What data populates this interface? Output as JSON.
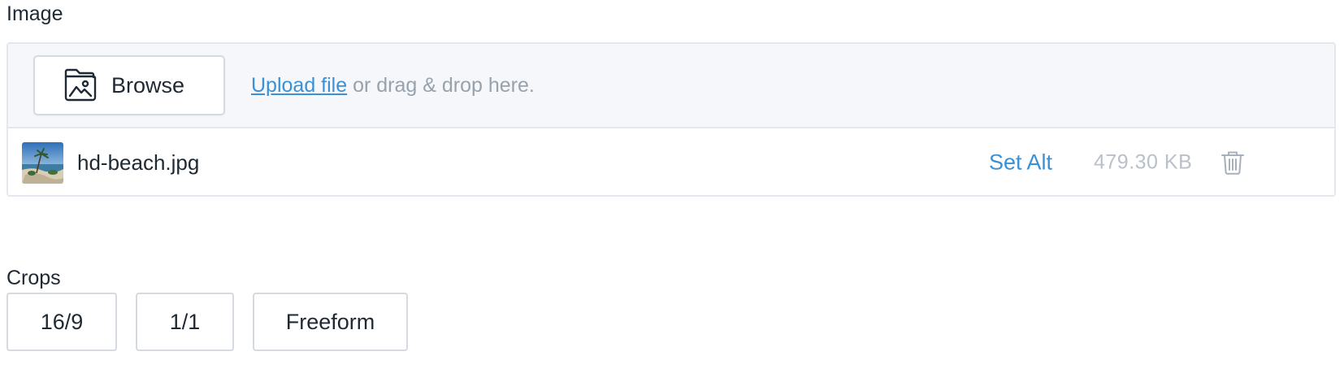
{
  "image_section": {
    "label": "Image",
    "dropzone": {
      "browse_label": "Browse",
      "browse_icon": "folder-image-icon",
      "upload_link": "Upload file",
      "drop_hint": " or drag & drop here."
    },
    "file": {
      "name": "hd-beach.jpg",
      "set_alt_label": "Set Alt",
      "size": "479.30 KB",
      "delete_icon": "trash-icon"
    }
  },
  "crops_section": {
    "label": "Crops",
    "options": [
      "16/9",
      "1/1",
      "Freeform"
    ]
  },
  "colors": {
    "accent": "#3a91d6",
    "muted_text": "#98a2ad",
    "border": "#d5dae1",
    "dropzone_bg": "#f5f7fa"
  }
}
